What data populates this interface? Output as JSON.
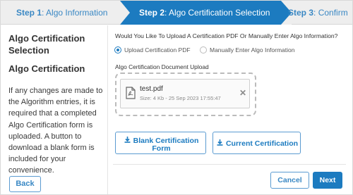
{
  "stepper": {
    "steps": [
      {
        "num": "Step 1",
        "sep": ":",
        "label": " Algo Information"
      },
      {
        "num": "Step 2",
        "sep": ":",
        "label": " Algo Certification Selection"
      },
      {
        "num": "Step 3",
        "sep": ":",
        "label": " Confirm"
      }
    ],
    "active_index": 1
  },
  "sidebar": {
    "title": "Algo Certification Selection",
    "section_title": "Algo Certification",
    "description": "If any changes are made to the Algorithm entries, it is required that a completed Algo Certification form is uploaded. A button to download a blank form is included for your convenience.",
    "back_label": "Back"
  },
  "main": {
    "question": "Would You Like To Upload A Certification PDF Or Manually Enter Algo Information?",
    "options": [
      {
        "label": "Upload Certification PDF",
        "selected": true
      },
      {
        "label": "Manually Enter Algo Information",
        "selected": false
      }
    ],
    "upload_label": "Algo Certification Document Upload",
    "file": {
      "name": "test.pdf",
      "meta": "Size: 4 Kb - 25 Sep 2023 17:55:47",
      "icon": "pdf-file-icon"
    },
    "blank_form_label_1": "Blank Certification",
    "blank_form_label_2": "Form",
    "current_cert_label": "Current Certification"
  },
  "footer": {
    "cancel_label": "Cancel",
    "next_label": "Next"
  },
  "colors": {
    "accent": "#1c7bc0",
    "step_inactive": "#3a88c4",
    "stepper_bg": "#eeeeee"
  }
}
